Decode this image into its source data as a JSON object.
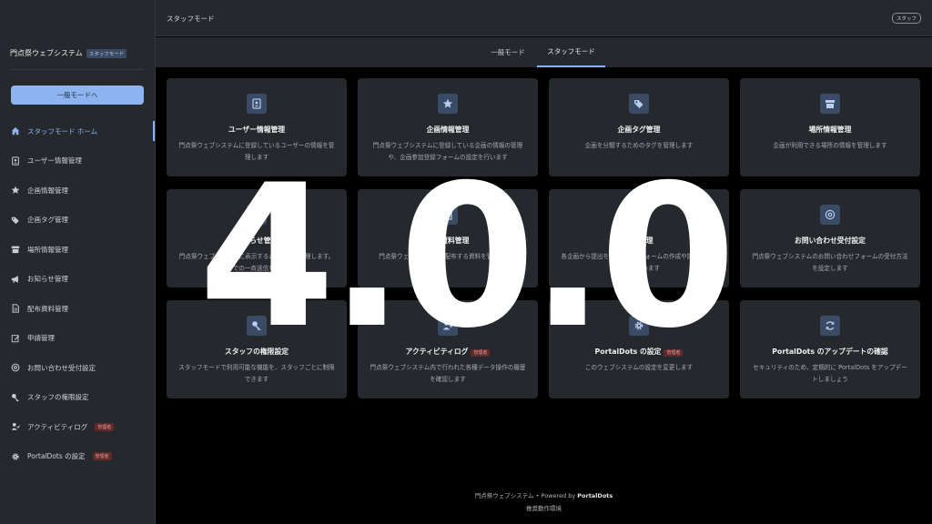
{
  "sidebar": {
    "brand_title": "門点祭ウェブシステム",
    "brand_badge": "スタッフモード",
    "general_mode_button": "一般モードへ",
    "items": [
      {
        "label": "スタッフモード ホーム",
        "icon": "home-icon"
      },
      {
        "label": "ユーザー情報管理",
        "icon": "contact-card-icon"
      },
      {
        "label": "企画情報管理",
        "icon": "star-icon"
      },
      {
        "label": "企画タグ管理",
        "icon": "tags-icon"
      },
      {
        "label": "場所情報管理",
        "icon": "store-icon"
      },
      {
        "label": "お知らせ管理",
        "icon": "megaphone-icon"
      },
      {
        "label": "配布資料管理",
        "icon": "document-icon"
      },
      {
        "label": "申請管理",
        "icon": "edit-icon"
      },
      {
        "label": "お問い合わせ受付設定",
        "icon": "at-icon"
      },
      {
        "label": "スタッフの権限設定",
        "icon": "key-icon"
      },
      {
        "label": "アクティビティログ",
        "icon": "user-activity-icon",
        "badge": "管理者"
      },
      {
        "label": "PortalDots の設定",
        "icon": "gear-icon",
        "badge": "管理者"
      }
    ]
  },
  "header": {
    "title": "スタッフモード",
    "badge": "スタッフ"
  },
  "tabs": [
    {
      "label": "一般モード"
    },
    {
      "label": "スタッフモード"
    }
  ],
  "cards": [
    {
      "title": "ユーザー情報管理",
      "desc": "門点祭ウェブシステムに登録しているユーザーの情報を管理します",
      "icon": "contact-card-icon"
    },
    {
      "title": "企画情報管理",
      "desc": "門点祭ウェブシステムに登録している企画の情報の管理や、企画参加登録フォームの設定を行います",
      "icon": "star-icon"
    },
    {
      "title": "企画タグ管理",
      "desc": "企画を分類するためのタグを管理します",
      "icon": "tags-icon"
    },
    {
      "title": "場所情報管理",
      "desc": "企画が利用できる場所の情報を管理します",
      "icon": "store-icon"
    },
    {
      "title": "お知らせ管理",
      "desc": "門点祭ウェブシステムに表示するお知らせを管理します。メールでの一斉送信も可能です",
      "icon": "megaphone-icon"
    },
    {
      "title": "配布資料管理",
      "desc": "門点祭ウェブシステムで配布する資料を管理します",
      "icon": "document-icon"
    },
    {
      "title": "申請管理",
      "desc": "各企画から提出を受ける申請フォームの作成や提出内容の確認を行います",
      "icon": "edit-icon"
    },
    {
      "title": "お問い合わせ受付設定",
      "desc": "門点祭ウェブシステムのお問い合わせフォームの受付方法を設定します",
      "icon": "at-icon"
    },
    {
      "title": "スタッフの権限設定",
      "desc": "スタッフモードで利用可能な機能を、スタッフごとに制限できます",
      "icon": "key-icon"
    },
    {
      "title": "アクティビティログ",
      "desc": "門点祭ウェブシステム内で行われた各種データ操作の履歴を確認します",
      "icon": "history-icon",
      "badge": "管理者"
    },
    {
      "title": "PortalDots の設定",
      "desc": "このウェブシステムの設定を変更します",
      "icon": "gear-icon",
      "badge": "管理者"
    },
    {
      "title": "PortalDots のアップデートの確認",
      "desc": "セキュリティのため、定期的に PortalDots をアップデートしましょう",
      "icon": "refresh-icon"
    }
  ],
  "footer": {
    "site": "門点祭ウェブシステム",
    "powered_by": "• Powered by",
    "product": "PortalDots",
    "link": "推奨動作環境"
  },
  "overlay": {
    "version": "4.0.0"
  },
  "colors": {
    "accent": "#8eb4f0",
    "surface": "#25282c",
    "background": "#000000",
    "admin_badge": "#5e2a2a"
  }
}
